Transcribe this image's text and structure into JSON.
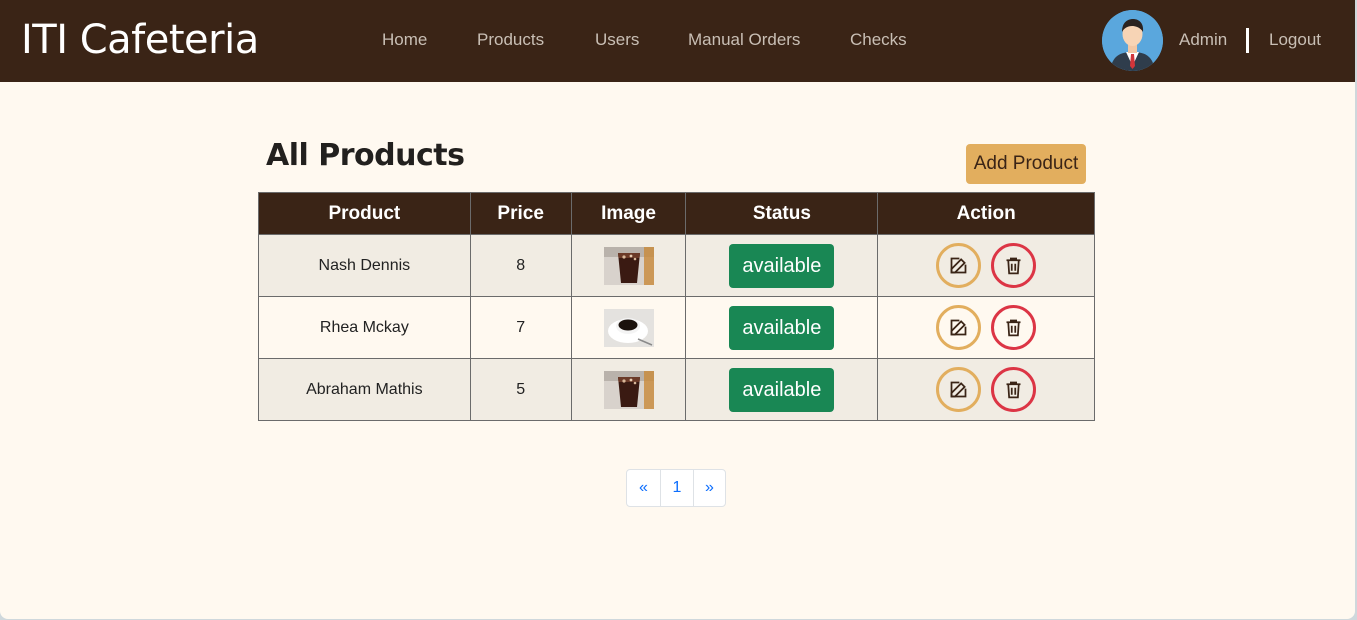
{
  "app": {
    "brand": "ITI Cafeteria"
  },
  "nav": {
    "links": [
      "Home",
      "Products",
      "Users",
      "Manual Orders",
      "Checks"
    ],
    "user": "Admin",
    "logout": "Logout"
  },
  "page": {
    "title": "All Products",
    "add_button": "Add Product"
  },
  "table": {
    "headers": [
      "Product",
      "Price",
      "Image",
      "Status",
      "Action"
    ],
    "rows": [
      {
        "product": "Nash Dennis",
        "price": "8",
        "image": "iced-drink-image",
        "status": "available"
      },
      {
        "product": "Rhea Mckay",
        "price": "7",
        "image": "coffee-cup-image",
        "status": "available"
      },
      {
        "product": "Abraham Mathis",
        "price": "5",
        "image": "iced-drink-image",
        "status": "available"
      }
    ]
  },
  "pagination": {
    "prev": "«",
    "current": "1",
    "next": "»"
  },
  "colors": {
    "navbar": "#3a2416",
    "accent": "#e2ae5e",
    "status": "#198754",
    "danger": "#dc3545",
    "background": "#fff9f0"
  },
  "icons": [
    "avatar-icon",
    "edit-icon",
    "trash-icon"
  ]
}
